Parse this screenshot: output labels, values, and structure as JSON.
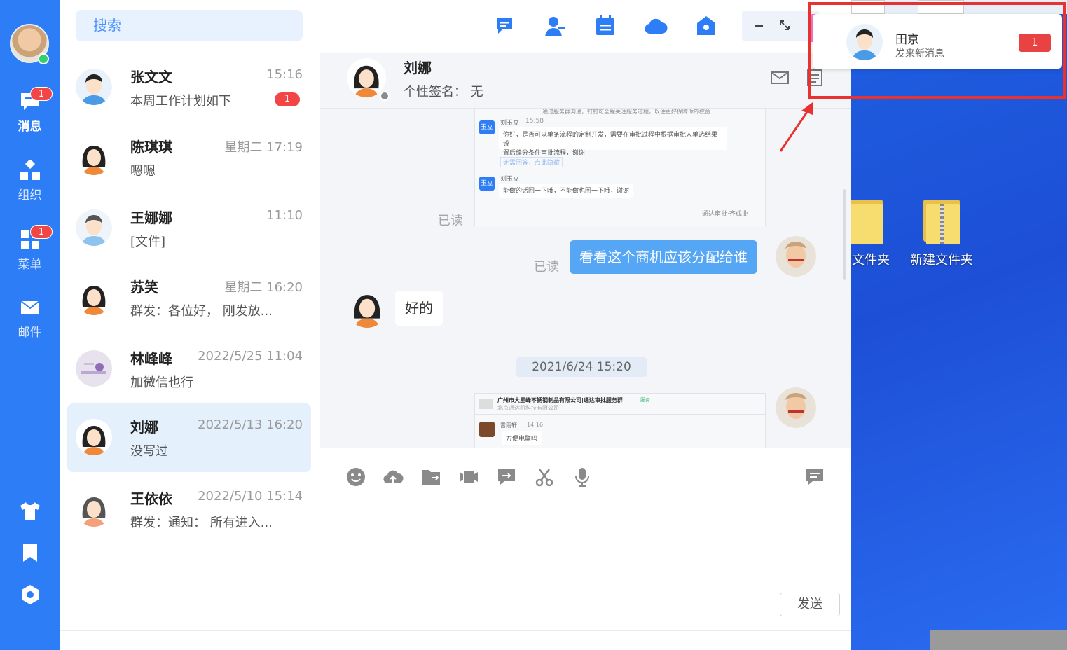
{
  "search": {
    "placeholder": "搜索"
  },
  "nav": {
    "items": [
      {
        "label": "消息",
        "badge": "1",
        "icon": "chat-icon",
        "active": true
      },
      {
        "label": "组织",
        "icon": "org-icon"
      },
      {
        "label": "菜单",
        "badge": "1",
        "icon": "grid-icon"
      },
      {
        "label": "邮件",
        "icon": "mail-icon"
      }
    ],
    "bottom_icons": [
      "shirt-icon",
      "bookmark-icon",
      "settings-hex-icon"
    ]
  },
  "contacts": [
    {
      "name": "张文文",
      "time": "15:16",
      "msg": "本周工作计划如下",
      "badge": "1"
    },
    {
      "name": "陈琪琪",
      "time": "星期二 17:19",
      "msg": "嗯嗯"
    },
    {
      "name": "王娜娜",
      "time": "11:10",
      "msg": "[文件]"
    },
    {
      "name": "苏笑",
      "time": "星期二 16:20",
      "msg": "群发：各位好， 刚发放..."
    },
    {
      "name": "林峰峰",
      "time": "2022/5/25 11:04",
      "msg": "加微信也行"
    },
    {
      "name": "刘娜",
      "time": "2022/5/13 16:20",
      "msg": "没写过"
    },
    {
      "name": "王依依",
      "time": "2022/5/10 15:14",
      "msg": "群发：通知： 所有进入..."
    }
  ],
  "chat": {
    "name": "刘娜",
    "signature": "个性签名： 无",
    "read_label_1": "已读",
    "read_label_2": "已读",
    "my_message": "看看这个商机应该分配给谁",
    "other_message": "好的",
    "date_divider": "2021/6/24 15:20",
    "shot1": {
      "header": "通过服务群沟通，钉钉可全程关注服务过程，以便更好保障你的权益",
      "sender": "刘玉立",
      "time": "15:58",
      "tag": "玉立",
      "line1": "你好，是否可以单条流程的定制开发，需要在审批过程中根据审批人单选结果设",
      "line2": "置后续分条件审批流程，谢谢",
      "link": "无需回答，点此隐藏",
      "sender2": "刘玉立",
      "line3": "能做的话回一下哦，不能做也回一下哦，谢谢",
      "footer": "通达审批·齐成业"
    },
    "shot2": {
      "group": "广州市大星峰不锈钢制品有限公司|通达审批服务群",
      "group_tag": "服务",
      "company": "北京通达凯科技有限公司",
      "sender": "雷雨轩",
      "time": "14:16",
      "line": "方便电联吗"
    },
    "send_label": "发送"
  },
  "notification": {
    "name": "田京",
    "sub": "发来新消息",
    "badge": "1"
  },
  "desktop": {
    "folder1": "建文件夹",
    "folder2": "新建文件夹"
  },
  "colors": {
    "nav_bg": "#2d7df6",
    "accent": "#55a6f5",
    "badge": "#f24646",
    "highlight_box": "#e8322f"
  }
}
